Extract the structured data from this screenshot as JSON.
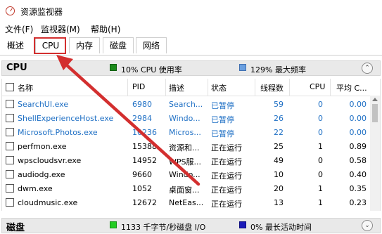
{
  "window": {
    "title": "资源监视器"
  },
  "menu": {
    "file": "文件(F)",
    "monitor": "监视器(M)",
    "help": "帮助(H)"
  },
  "tabs": [
    {
      "label": "概述"
    },
    {
      "label": "CPU"
    },
    {
      "label": "内存"
    },
    {
      "label": "磁盘"
    },
    {
      "label": "网络"
    }
  ],
  "cpu_section": {
    "title": "CPU",
    "usage_text": "10% CPU 使用率",
    "freq_text": "129% 最大频率",
    "usage_color": "#1b8a1b",
    "freq_color": "#6a9fe0"
  },
  "table": {
    "headers": {
      "name": "名称",
      "pid": "PID",
      "desc": "描述",
      "status": "状态",
      "threads": "线程数",
      "cpu": "CPU",
      "avg": "平均 C..."
    },
    "rows": [
      {
        "name": "SearchUI.exe",
        "pid": "6980",
        "desc": "Search...",
        "status": "已暂停",
        "threads": "59",
        "cpu": "0",
        "avg": "0.00",
        "suspended": true
      },
      {
        "name": "ShellExperienceHost.exe",
        "pid": "2984",
        "desc": "Windo...",
        "status": "已暂停",
        "threads": "26",
        "cpu": "0",
        "avg": "0.00",
        "suspended": true
      },
      {
        "name": "Microsoft.Photos.exe",
        "pid": "10236",
        "desc": "Micros...",
        "status": "已暂停",
        "threads": "22",
        "cpu": "0",
        "avg": "0.00",
        "suspended": true
      },
      {
        "name": "perfmon.exe",
        "pid": "15388",
        "desc": "资源和...",
        "status": "正在运行",
        "threads": "25",
        "cpu": "1",
        "avg": "0.89",
        "suspended": false
      },
      {
        "name": "wpscloudsvr.exe",
        "pid": "14952",
        "desc": "WPS服...",
        "status": "正在运行",
        "threads": "49",
        "cpu": "0",
        "avg": "0.58",
        "suspended": false
      },
      {
        "name": "audiodg.exe",
        "pid": "9660",
        "desc": "Windo...",
        "status": "正在运行",
        "threads": "10",
        "cpu": "0",
        "avg": "0.40",
        "suspended": false
      },
      {
        "name": "dwm.exe",
        "pid": "1052",
        "desc": "桌面窗...",
        "status": "正在运行",
        "threads": "20",
        "cpu": "1",
        "avg": "0.35",
        "suspended": false
      },
      {
        "name": "cloudmusic.exe",
        "pid": "12672",
        "desc": "NetEas...",
        "status": "正在运行",
        "threads": "13",
        "cpu": "1",
        "avg": "0.23",
        "suspended": false
      }
    ]
  },
  "disk_section": {
    "title": "磁盘",
    "io_text": "1133 千字节/秒磁盘 I/O",
    "active_text": "0% 最长活动时间",
    "io_color": "#22cc22",
    "active_color": "#1a1ab8"
  },
  "annotation": {
    "color": "#d32f2f"
  }
}
